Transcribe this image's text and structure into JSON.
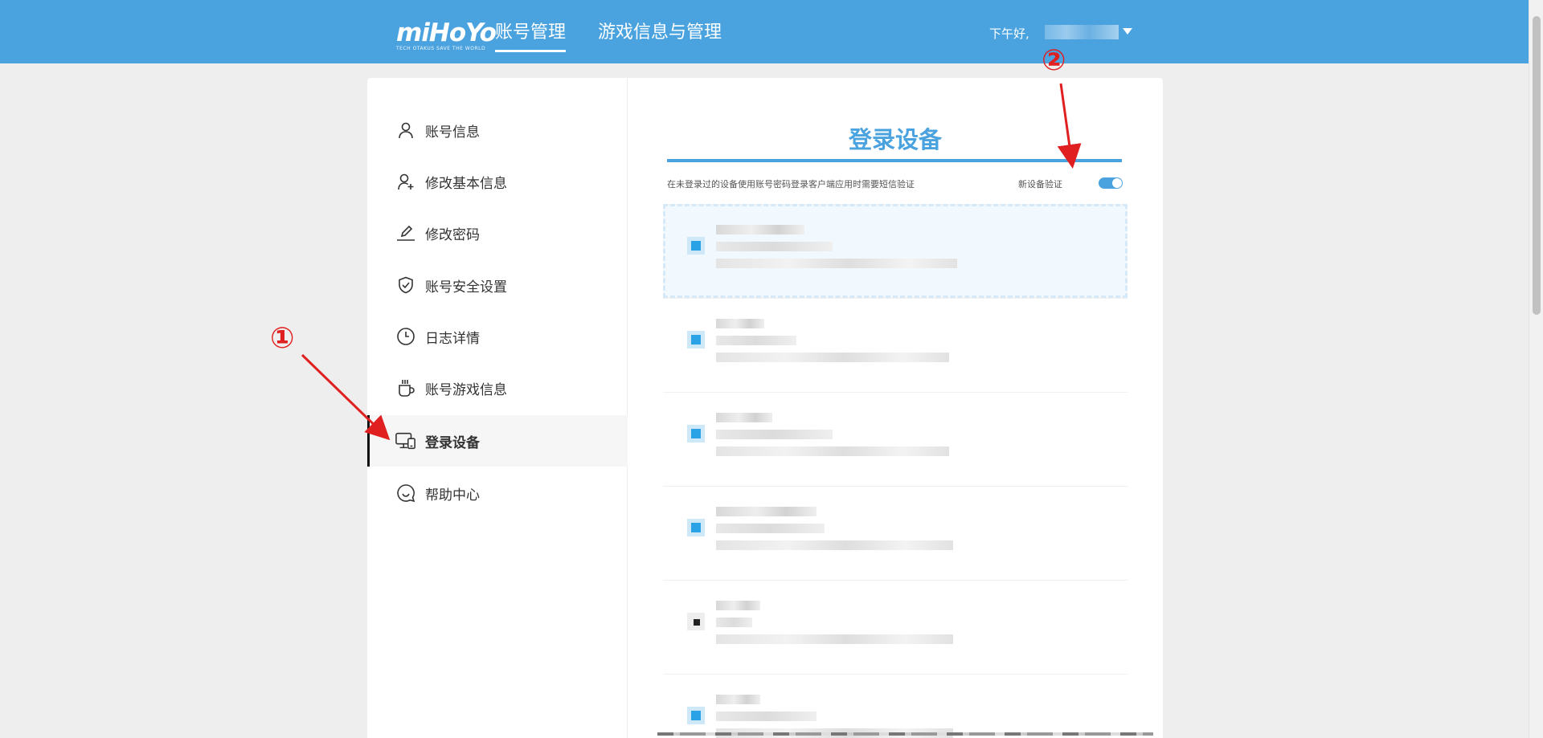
{
  "header": {
    "logo_text": "miHoYo",
    "logo_tagline": "TECH OTAKUS SAVE THE WORLD",
    "nav": [
      {
        "label": "账号管理",
        "active": true
      },
      {
        "label": "游戏信息与管理",
        "active": false
      }
    ],
    "greeting": "下午好,"
  },
  "sidebar": {
    "items": [
      {
        "label": "账号信息",
        "icon": "user-icon"
      },
      {
        "label": "修改基本信息",
        "icon": "user-edit-icon"
      },
      {
        "label": "修改密码",
        "icon": "pencil-icon"
      },
      {
        "label": "账号安全设置",
        "icon": "shield-check-icon"
      },
      {
        "label": "日志详情",
        "icon": "clock-icon"
      },
      {
        "label": "账号游戏信息",
        "icon": "cup-icon"
      },
      {
        "label": "登录设备",
        "icon": "devices-icon",
        "active": true
      },
      {
        "label": "帮助中心",
        "icon": "chat-smile-icon"
      }
    ]
  },
  "main": {
    "title": "登录设备",
    "description": "在未登录过的设备使用账号密码登录客户端应用时需要短信验证",
    "toggle_label": "新设备验证",
    "toggle_on": true
  },
  "annotations": [
    "①",
    "②"
  ],
  "colors": {
    "accent": "#4aa3df",
    "annotation": "#e02020"
  }
}
